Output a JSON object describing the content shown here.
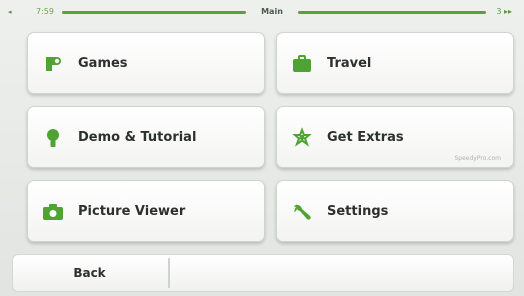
{
  "status_bar": {
    "arrow": "◂",
    "time": "7:59",
    "title": "Main",
    "signal": "3 ▸▸"
  },
  "menu": {
    "games": {
      "label": "Games",
      "icon": "games-icon"
    },
    "travel": {
      "label": "Travel",
      "icon": "suitcase-icon"
    },
    "demo": {
      "label": "Demo & Tutorial",
      "icon": "lightbulb-icon"
    },
    "extras": {
      "label": "Get Extras",
      "icon": "download-icon",
      "watermark": "SpeedyPro.com"
    },
    "picture": {
      "label": "Picture Viewer",
      "icon": "camera-icon"
    },
    "settings": {
      "label": "Settings",
      "icon": "wrench-icon"
    }
  },
  "bottom_bar": {
    "back_label": "Back"
  },
  "colors": {
    "accent_green": "#58a23a",
    "tile_bg": "#ffffff",
    "text": "#2c312d"
  }
}
